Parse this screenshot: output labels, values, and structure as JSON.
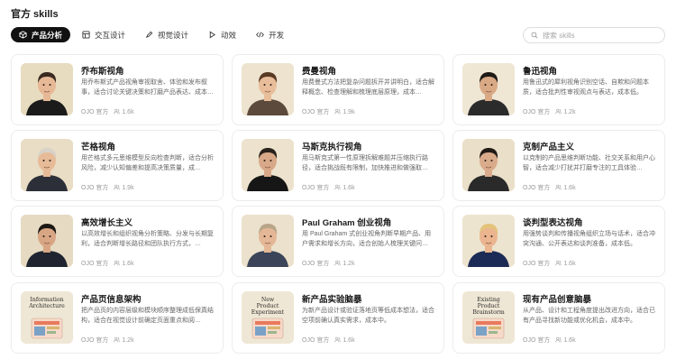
{
  "page": {
    "title": "官方 skills"
  },
  "tabs": [
    {
      "label": "产品分析",
      "icon": "cube-icon",
      "active": true
    },
    {
      "label": "交互设计",
      "icon": "layout-icon",
      "active": false
    },
    {
      "label": "视觉设计",
      "icon": "pen-icon",
      "active": false
    },
    {
      "label": "动效",
      "icon": "play-icon",
      "active": false
    },
    {
      "label": "开发",
      "icon": "code-icon",
      "active": false
    }
  ],
  "search": {
    "placeholder": "搜索 skills",
    "value": ""
  },
  "cards": [
    {
      "title": "乔布斯视角",
      "desc": "用乔布斯式产品视角审视取舍、体验和发布叙事，适合讨论关键决策和打磨产品表达、成本…",
      "author": "OJO 官方",
      "users": "1.6k",
      "thumb_color": "#e8dcc0"
    },
    {
      "title": "费曼视角",
      "desc": "用费曼式方法把复杂问题拆开并讲明白，适合解释概念、检查理解和梳理底层原理，成本…",
      "author": "OJO 官方",
      "users": "1.9k",
      "thumb_color": "#ede3cf"
    },
    {
      "title": "鲁迅视角",
      "desc": "用鲁迅式的犀利视角识别空话、自欺和问题本质，适合批判性审视观点与表达，成本低。",
      "author": "OJO 官方",
      "users": "1.2k",
      "thumb_color": "#efe6d4"
    },
    {
      "title": "芒格视角",
      "desc": "用芒格式多元思维模型反向检查判断，适合分析风险，减少认知偏差和提高决策质量，成…",
      "author": "OJO 官方",
      "users": "1.9k",
      "thumb_color": "#e9ddc5"
    },
    {
      "title": "马斯克执行视角",
      "desc": "用马斯克式第一性原理拆解难题并压缩执行路径，适合挑战既有限制，加快推进和做强取…",
      "author": "OJO 官方",
      "users": "1.6k",
      "thumb_color": "#ece2cd"
    },
    {
      "title": "克制产品主义",
      "desc": "以克制的产品思维判断功能、社交关系和用户心智，适合减少打扰并打磨专注的工具体验…",
      "author": "OJO 官方",
      "users": "1.6k",
      "thumb_color": "#eadfc9"
    },
    {
      "title": "高效增长主义",
      "desc": "以高效增长和组织视角分析策略、分发与长期复利，适合判断增长路径和团队执行方式，…",
      "author": "OJO 官方",
      "users": "1.6k",
      "thumb_color": "#e6dac2"
    },
    {
      "title": "Paul Graham 创业视角",
      "desc": "用 Paul Graham 式创业视角判断早期产品、用户需求和增长方向，适合创始人梳理关键问…",
      "author": "OJO 官方",
      "users": "1.2k",
      "thumb_color": "#ebe1cc"
    },
    {
      "title": "谈判型表达视角",
      "desc": "用强势谈判和传播视角组织立场与话术，适合冲突沟通、公开表达和谈判准备，成本低。",
      "author": "OJO 官方",
      "users": "1.6k",
      "thumb_color": "#ede4d0"
    },
    {
      "title": "产品页信息架构",
      "desc": "把产品页的内容层级和模块顺序整理成低保真结构，适合在视觉设计前确定页面重点和阅…",
      "author": "OJO 官方",
      "users": "1.2k",
      "thumb_color": "#efe7d5",
      "thumb_text": "Information Architecture"
    },
    {
      "title": "新产品实验脑暴",
      "desc": "为新产品设计或验证落地页等低成本想法，适合空项前确认真实需求，成本中。",
      "author": "OJO 官方",
      "users": "1.6k",
      "thumb_color": "#efe7d5",
      "thumb_text": "New Product Experiment"
    },
    {
      "title": "现有产品创意脑暴",
      "desc": "从产品、设计和工程角度提出改进方向，适合已有产品寻找新功能或优化机会，成本中。",
      "author": "OJO 官方",
      "users": "1.6k",
      "thumb_color": "#efe7d5",
      "thumb_text": "Existing Product Brainstorm"
    }
  ]
}
